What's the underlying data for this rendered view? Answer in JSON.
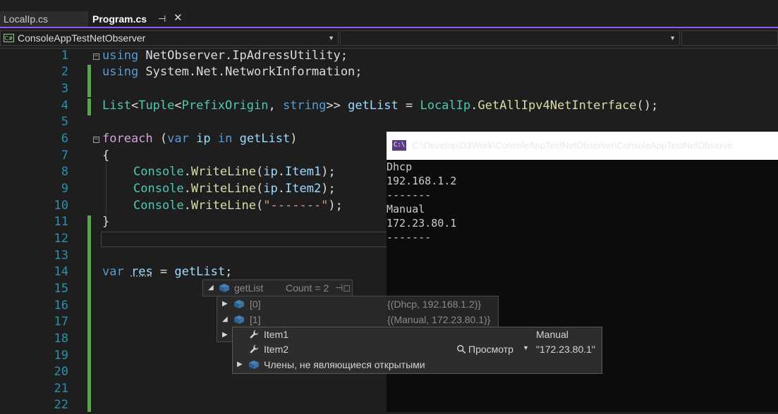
{
  "tabs": [
    {
      "label": "LocalIp.cs",
      "active": false
    },
    {
      "label": "Program.cs",
      "active": true,
      "pin": "⊣",
      "close": "✕"
    }
  ],
  "nav": {
    "project": "ConsoleAppTestNetObserver",
    "member": "",
    "extra": ""
  },
  "editor": {
    "line_numbers": [
      "1",
      "2",
      "3",
      "4",
      "5",
      "6",
      "7",
      "8",
      "9",
      "10",
      "11",
      "12",
      "13",
      "14",
      "15",
      "16",
      "17",
      "18",
      "19",
      "20",
      "21",
      "22"
    ],
    "lines": {
      "l1": [
        "using",
        " NetObserver",
        ".",
        "IpAdressUtility",
        ";"
      ],
      "l2": [
        "using",
        " System",
        ".",
        "Net",
        ".",
        "NetworkInformation",
        ";"
      ],
      "l4": [
        "List",
        "<",
        "Tuple",
        "<",
        "PrefixOrigin",
        ", ",
        "string",
        ">> ",
        "getList",
        " = ",
        "LocalIp",
        ".",
        "GetAllIpv4NetInterface",
        "();"
      ],
      "l6": [
        "foreach",
        " (",
        "var",
        " ",
        "ip",
        " ",
        "in",
        " ",
        "getList",
        ")"
      ],
      "l7": "{",
      "l8": [
        "Console",
        ".",
        "WriteLine",
        "(",
        "ip",
        ".",
        "Item1",
        ");"
      ],
      "l9": [
        "Console",
        ".",
        "WriteLine",
        "(",
        "ip",
        ".",
        "Item2",
        ");"
      ],
      "l10": [
        "Console",
        ".",
        "WriteLine",
        "(",
        "\"-------\"",
        ");"
      ],
      "l11": "}",
      "l14": [
        "var",
        " ",
        "res",
        " = ",
        "getList",
        ";"
      ]
    }
  },
  "console": {
    "title_path": "C:\\Develop\\D3Work\\ConsoleAppTestNetObserver\\ConsoleAppTestNetObserve",
    "icon_text": "C:\\",
    "output": [
      "Dhcp",
      "192.168.1.2",
      "-------",
      "Manual",
      "172.23.80.1",
      "-------"
    ]
  },
  "datatip": {
    "root_name": "getList",
    "root_value": "Count = 2",
    "items": [
      {
        "name": "[0]",
        "value": "{(Dhcp, 192.168.1.2)}"
      },
      {
        "name": "[1]",
        "value": "{(Manual, 172.23.80.1)}"
      }
    ],
    "children": [
      {
        "name": "Item1",
        "value": "Manual"
      },
      {
        "name": "Item2",
        "value": "\"172.23.80.1\"",
        "view_label": "Просмотр"
      },
      {
        "name": "Члены, не являющиеся открытыми",
        "value": ""
      }
    ]
  },
  "colors": {
    "accent": "#8b5cf6",
    "keyword": "#569cd6",
    "type": "#4ec9b0",
    "method": "#dcdcaa",
    "identifier": "#9cdcfe",
    "string": "#d69d85",
    "control": "#d8a0df",
    "line_number": "#2b91af",
    "change_bar": "#57a64a"
  }
}
